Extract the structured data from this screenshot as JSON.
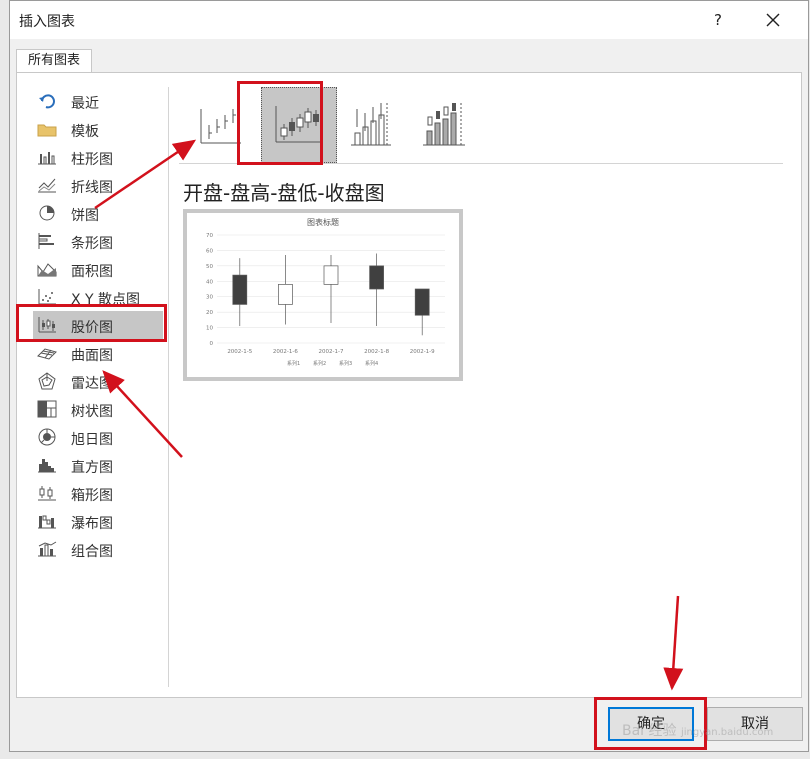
{
  "dialog": {
    "title": "插入图表",
    "help_label": "?",
    "tab_label": "所有图表"
  },
  "sidebar": {
    "items": [
      {
        "label": "最近",
        "icon": "undo-icon",
        "selected": false
      },
      {
        "label": "模板",
        "icon": "folder-icon",
        "selected": false
      },
      {
        "label": "柱形图",
        "icon": "column-chart-icon",
        "selected": false
      },
      {
        "label": "折线图",
        "icon": "line-chart-icon",
        "selected": false
      },
      {
        "label": "饼图",
        "icon": "pie-chart-icon",
        "selected": false
      },
      {
        "label": "条形图",
        "icon": "bar-chart-icon",
        "selected": false
      },
      {
        "label": "面积图",
        "icon": "area-chart-icon",
        "selected": false
      },
      {
        "label": "X Y 散点图",
        "icon": "scatter-chart-icon",
        "selected": false
      },
      {
        "label": "股价图",
        "icon": "stock-chart-icon",
        "selected": true
      },
      {
        "label": "曲面图",
        "icon": "surface-chart-icon",
        "selected": false
      },
      {
        "label": "雷达图",
        "icon": "radar-chart-icon",
        "selected": false
      },
      {
        "label": "树状图",
        "icon": "treemap-chart-icon",
        "selected": false
      },
      {
        "label": "旭日图",
        "icon": "sunburst-chart-icon",
        "selected": false
      },
      {
        "label": "直方图",
        "icon": "histogram-chart-icon",
        "selected": false
      },
      {
        "label": "箱形图",
        "icon": "box-whisker-chart-icon",
        "selected": false
      },
      {
        "label": "瀑布图",
        "icon": "waterfall-chart-icon",
        "selected": false
      },
      {
        "label": "组合图",
        "icon": "combo-chart-icon",
        "selected": false
      }
    ]
  },
  "subtypes": {
    "selected_title": "开盘-盘高-盘低-收盘图",
    "items": [
      {
        "icon": "high-low-close-icon",
        "selected": false
      },
      {
        "icon": "open-high-low-close-icon",
        "selected": true
      },
      {
        "icon": "volume-high-low-close-icon",
        "selected": false
      },
      {
        "icon": "volume-open-high-low-close-icon",
        "selected": false
      }
    ]
  },
  "preview": {
    "chart_data": {
      "type": "candlestick",
      "title": "图表标题",
      "categories": [
        "2002-1-5",
        "2002-1-6",
        "2002-1-7",
        "2002-1-8",
        "2002-1-9"
      ],
      "series": [
        {
          "name": "系列1",
          "values": [
            44,
            25,
            55,
            11
          ]
        },
        {
          "name": "系列2",
          "values": [
            25,
            38,
            57,
            12
          ]
        },
        {
          "name": "系列3",
          "values": [
            38,
            50,
            57,
            13
          ]
        },
        {
          "name": "系列4",
          "values": [
            50,
            35,
            58,
            11
          ]
        }
      ],
      "ohlc": [
        {
          "open": 44,
          "close": 25,
          "high": 55,
          "low": 11
        },
        {
          "open": 25,
          "close": 38,
          "high": 57,
          "low": 12
        },
        {
          "open": 38,
          "close": 50,
          "high": 57,
          "low": 13
        },
        {
          "open": 50,
          "close": 35,
          "high": 58,
          "low": 11
        },
        {
          "open": 35,
          "close": 18,
          "high": 34,
          "low": 5
        }
      ],
      "yticks": [
        "0",
        "10",
        "20",
        "30",
        "40",
        "50",
        "60",
        "70"
      ],
      "ylim": [
        0,
        70
      ],
      "legend": [
        "系列1",
        "系列2",
        "系列3",
        "系列4"
      ],
      "legend_position": "bottom",
      "grid": true,
      "colors": {
        "down": "#404040",
        "up": "#ffffff",
        "outline": "#595959",
        "grid": "#e6e6e6"
      }
    }
  },
  "footer": {
    "ok_label": "确定",
    "cancel_label": "取消"
  },
  "annotations": {
    "highlight_color": "#d2111c"
  },
  "watermark": {
    "text": "Bai 经验",
    "url_text": "jingyan.baidu.com"
  }
}
